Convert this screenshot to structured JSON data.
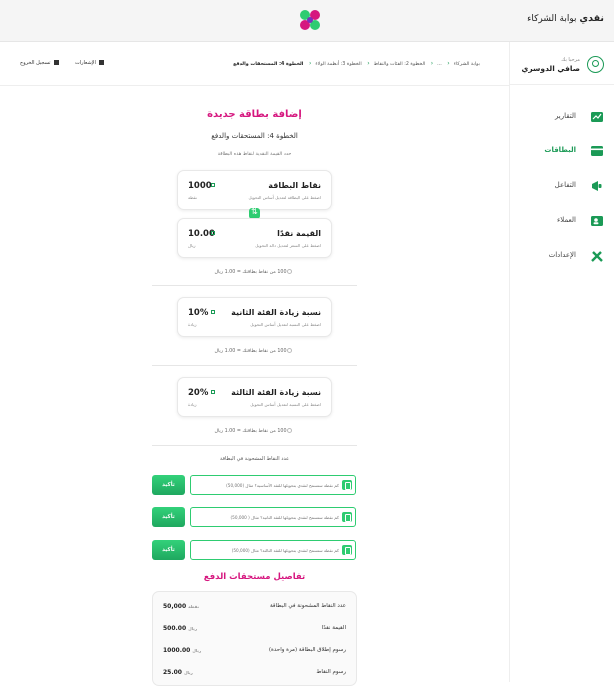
{
  "app": {
    "title": "نقدي",
    "portal": "بوابة الشركاء"
  },
  "colors": {
    "accent": "#1b9a56",
    "brand_pink": "#d6177f",
    "brand_green": "#2ecc71"
  },
  "user": {
    "greeting": "مرحبا بك",
    "name": "صافي الدوسري"
  },
  "sidebar": {
    "items": [
      {
        "label": "التقارير",
        "icon": "reports-icon",
        "active": false
      },
      {
        "label": "البطاقات",
        "icon": "cards-icon",
        "active": true
      },
      {
        "label": "التفاعل",
        "icon": "megaphone-icon",
        "active": false
      },
      {
        "label": "العملاء",
        "icon": "customers-icon",
        "active": false
      },
      {
        "label": "الإعدادات",
        "icon": "tools-icon",
        "active": false
      }
    ]
  },
  "breadcrumb": {
    "items": [
      "بوابة الشركاء",
      "...",
      "الخطوة 2: الفئات والنقاط",
      "الخطوة 3: أنظمة الولاء",
      "الخطوة 4: المستحقات والدفع"
    ]
  },
  "top_actions": {
    "notifications": "الإشعارات",
    "logout": "تسجيل الخروج"
  },
  "page": {
    "title": "إضافة بطاقة جديدة",
    "step": "الخطوة 4: المستحقات والدفع",
    "hint": "حدد القيمة النقدية لنقاط هذه البطاقة"
  },
  "cards": {
    "points": {
      "title": "نقاط البطاقة",
      "desc": "اضغط على البطاقة لتعديل أساس التحويل",
      "value": "1000",
      "unit": "نقطة"
    },
    "cash": {
      "title": "القيمة نقدًا",
      "desc": "اضغط على السعر لتعديل دالة التحويل",
      "value": "10.00",
      "unit": "ريال"
    },
    "tier2": {
      "title": "نسبة زيادة الفئة الثانية",
      "desc": "اضغط على النسبة لتعديل أساس التحويل",
      "value": "10%",
      "unit": "زيادة"
    },
    "tier3": {
      "title": "نسبة زيادة الفئة الثالثة",
      "desc": "اضغط على النسبة لتعديل أساس التحويل",
      "value": "20%",
      "unit": "زيادة"
    }
  },
  "equations": {
    "eq1": "100 من نقاط  بطاقتك = 1.00 ريال",
    "eq2": "100 من نقاط  بطاقتك = 1.00 ريال",
    "eq3": "100 من نقاط  بطاقتك = 1.00 ريال"
  },
  "charged": {
    "label": "عدد النقاط المشحونة في البطاقة",
    "fields": [
      {
        "placeholder": "كم نقطة ستسمح لنقدي بتحويلها للفئة الأساسية؟ مثال (50,000)",
        "button": "تأكيد"
      },
      {
        "placeholder": "كم نقطة ستسمح لنقدي بتحويلها للفئة الثانية؟ مثال ( 50,000)",
        "button": "تأكيد"
      },
      {
        "placeholder": "كم نقطة ستسمح لنقدي بتحويلها للفئة الثالثة؟ مثال (50,000)",
        "button": "تأكيد"
      }
    ]
  },
  "payment": {
    "title": "تفاصيل مستحقات الدفع",
    "rows": [
      {
        "label": "عدد النقاط المشحونة في البطاقة",
        "value": "50,000",
        "unit": "نقطة"
      },
      {
        "label": "القيمة نقدًا",
        "value": "500.00",
        "unit": "ريال"
      },
      {
        "label": "رسوم إطلاق البطاقة (مرة واحدة)",
        "value": "1000.00",
        "unit": "ريال"
      },
      {
        "label": "رسوم النقاط",
        "value": "25.00",
        "unit": "ريال"
      }
    ]
  }
}
